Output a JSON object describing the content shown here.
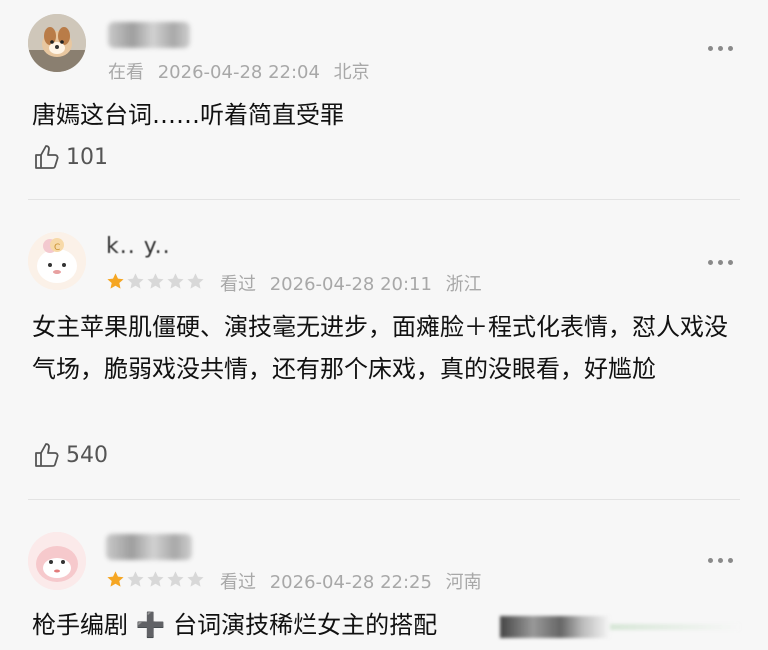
{
  "colors": {
    "background": "#f7f7f7",
    "meta_text": "#a8a8a8",
    "star_filled": "#f5a623",
    "star_empty": "#d8d8d8"
  },
  "comments": [
    {
      "status": "在看",
      "datetime": "2026-04-28 22:04",
      "location": "北京",
      "text": "唐嫣这台词……听着简直受罪",
      "likes": "101",
      "rating": null,
      "avatar_icon": "dog-photo-icon"
    },
    {
      "username_partial": "k.. y..",
      "status": "看过",
      "datetime": "2026-04-28 20:11",
      "location": "浙江",
      "text": "女主苹果肌僵硬、演技毫无进步，面瘫脸＋程式化表情，怼人戏没气场，脆弱戏没共情，还有那个床戏，真的没眼看，好尴尬",
      "likes": "540",
      "rating": 1,
      "rating_max": 5,
      "avatar_icon": "cartoon-avatar-icon"
    },
    {
      "status": "看过",
      "datetime": "2026-04-28 22:25",
      "location": "河南",
      "text": "枪手编剧 ➕ 台词演技稀烂女主的搭配",
      "rating": 1,
      "rating_max": 5,
      "avatar_icon": "cartoon-avatar-icon"
    }
  ]
}
